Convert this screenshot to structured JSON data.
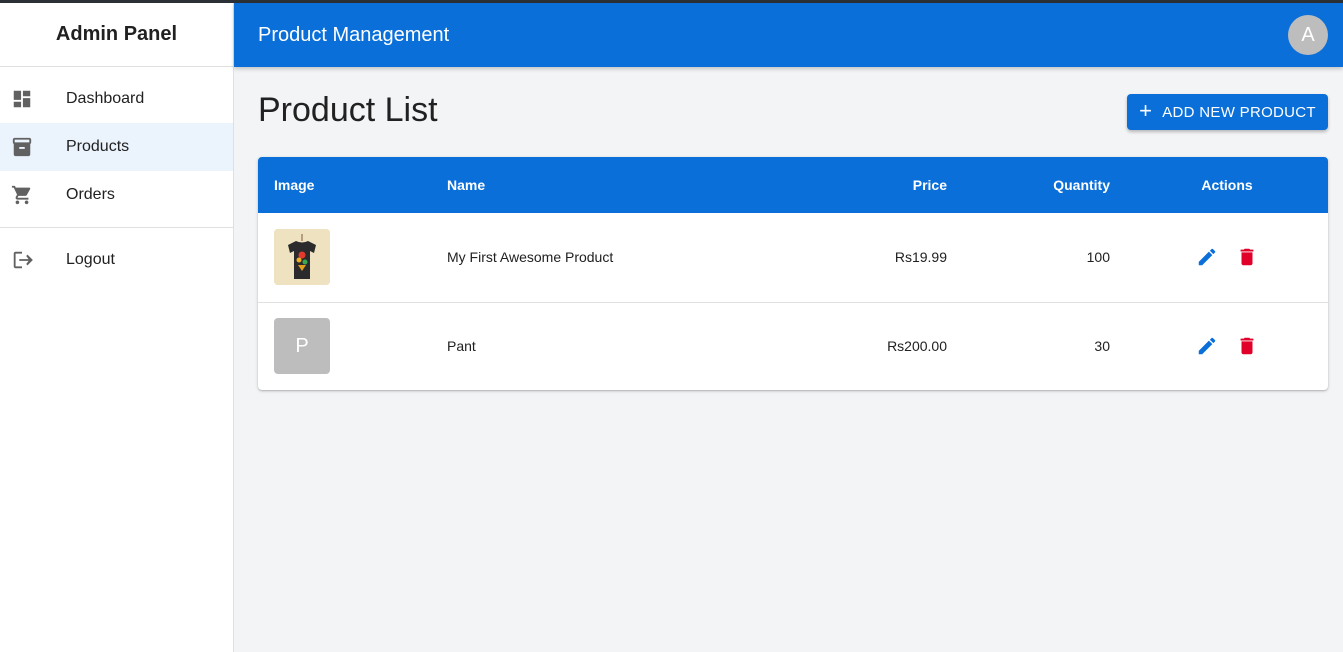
{
  "sidebar": {
    "title": "Admin Panel",
    "items": [
      {
        "label": "Dashboard",
        "icon": "dashboard-icon",
        "active": false
      },
      {
        "label": "Products",
        "icon": "archive-box-icon",
        "active": true
      },
      {
        "label": "Orders",
        "icon": "shopping-cart-icon",
        "active": false
      }
    ],
    "logout": {
      "label": "Logout",
      "icon": "logout-icon"
    }
  },
  "appbar": {
    "title": "Product Management",
    "avatar_initial": "A"
  },
  "main": {
    "page_title": "Product List",
    "add_button_label": "ADD NEW PRODUCT",
    "table": {
      "columns": [
        "Image",
        "Name",
        "Price",
        "Quantity",
        "Actions"
      ],
      "rows": [
        {
          "image": "tshirt-thumbnail",
          "name": "My First Awesome Product",
          "price": "Rs19.99",
          "quantity": "100"
        },
        {
          "image_placeholder": "P",
          "name": "Pant",
          "price": "Rs200.00",
          "quantity": "30"
        }
      ]
    }
  },
  "colors": {
    "primary": "#0a6fd8",
    "danger": "#e0002a",
    "active_nav_bg": "#ebf3fc"
  }
}
